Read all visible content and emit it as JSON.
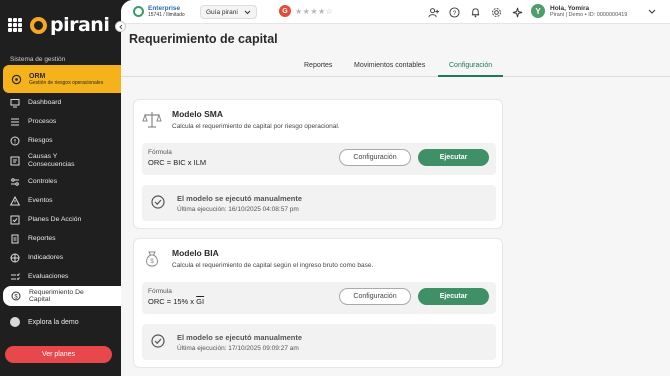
{
  "brand": {
    "name": "pirani"
  },
  "sidebar": {
    "section_label": "Sistema de gestión",
    "module": {
      "title": "ORM",
      "subtitle": "Gestión de riesgos operacionales"
    },
    "items": [
      {
        "label": "Dashboard",
        "icon": "monitor-icon"
      },
      {
        "label": "Procesos",
        "icon": "list-icon"
      },
      {
        "label": "Riesgos",
        "icon": "alert-circle-icon"
      },
      {
        "label": "Causas Y Consecuencias",
        "icon": "cause-icon"
      },
      {
        "label": "Controles",
        "icon": "sliders-icon"
      },
      {
        "label": "Eventos",
        "icon": "warning-icon"
      },
      {
        "label": "Planes De Acción",
        "icon": "checkbox-icon"
      },
      {
        "label": "Reportes",
        "icon": "report-icon"
      },
      {
        "label": "Indicadores",
        "icon": "indicator-icon"
      },
      {
        "label": "Evaluaciones",
        "icon": "evaluation-icon"
      },
      {
        "label": "Requerimiento De Capital",
        "icon": "capital-icon",
        "active": true
      }
    ],
    "demo_label": "Explora la demo",
    "plans_button": "Ver planes"
  },
  "topbar": {
    "plan_title": "Enterprise",
    "plan_sub": "15741 / Ilimitado",
    "guide_label": "Guía pirani",
    "rating_badge": "G",
    "stars": "★★★★☆",
    "icons": [
      "add-user-icon",
      "help-icon",
      "bell-icon",
      "gear-icon",
      "sparkle-icon"
    ],
    "user_initial": "Y",
    "user_greeting": "Hola, Yomira",
    "user_sub": "Pirani | Demo • ID: 0000000419"
  },
  "page": {
    "title": "Requerimiento de capital",
    "tabs": [
      {
        "label": "Reportes"
      },
      {
        "label": "Movimientos contables"
      },
      {
        "label": "Configuración",
        "active": true
      }
    ]
  },
  "models": [
    {
      "title": "Modelo SMA",
      "description": "Calcula el requerimiento de capital por riesgo operacional.",
      "formula_label": "Fórmula",
      "formula": "ORC = BIC x ILM",
      "config_button": "Configuración",
      "run_button": "Ejecutar",
      "status_title": "El modelo se ejecutó manualmente",
      "status_sub": "Última ejecución: 16/10/2025 04:08:57 pm"
    },
    {
      "title": "Modelo BIA",
      "description": "Calcula el requerimiento de capital según el ingreso bruto como base.",
      "formula_label": "Fórmula",
      "formula_prefix": "ORC = 15% x ",
      "formula_overline": "GI",
      "config_button": "Configuración",
      "run_button": "Ejecutar",
      "status_title": "El modelo se ejecutó manualmente",
      "status_sub": "Última ejecución: 17/10/2025 09:09:27 am"
    }
  ],
  "colors": {
    "accent": "#f5b21b",
    "primary": "#3f8f67",
    "danger": "#e8474c"
  }
}
